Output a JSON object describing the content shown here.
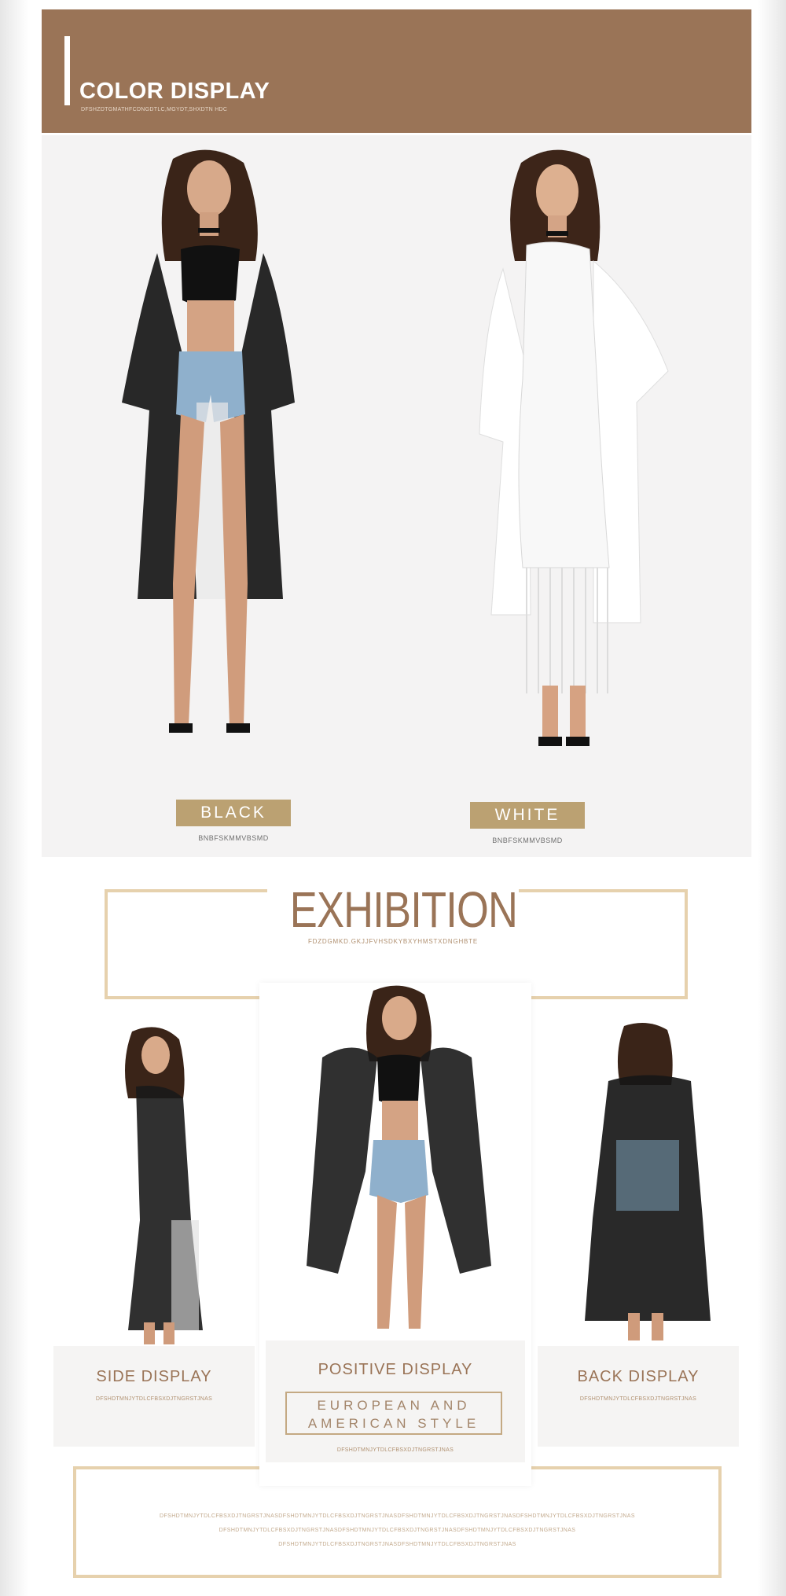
{
  "color_display": {
    "title": "COLOR DISPLAY",
    "subtitle": "DFSHZDTGMATHFCDNGDTLC,MGYDT,SHXDTN HDC"
  },
  "colors": [
    {
      "label": "BLACK",
      "code": "BNBFSKMMVBSMD",
      "swatch": "#111111"
    },
    {
      "label": "WHITE",
      "code": "BNBFSKMMVBSMD",
      "swatch": "#f2f2f2"
    }
  ],
  "exhibition": {
    "title": "EXHIBITION",
    "subtitle": "FDZDGMKD.GKJJFVHSDKYBXYHMSTXDNGHBTE"
  },
  "displays": {
    "side": {
      "title": "SIDE DISPLAY",
      "code": "DFSHDTMNJYTDLCFBSXDJTNGRSTJNAS"
    },
    "positive": {
      "title": "POSITIVE DISPLAY",
      "code": "DFSHDTMNJYTDLCFBSXDJTNGRSTJNAS"
    },
    "back": {
      "title": "BACK DISPLAY",
      "code": "DFSHDTMNJYTDLCFBSXDJTNGRSTJNAS"
    }
  },
  "style_tag": {
    "line1": "EUROPEAN AND",
    "line2": "AMERICAN STYLE"
  },
  "footer_lines": [
    "DFSHDTMNJYTDLCFBSXDJTNGRSTJNASDFSHDTMNJYTDLCFBSXDJTNGRSTJNASDFSHDTMNJYTDLCFBSXDJTNGRSTJNASDFSHDTMNJYTDLCFBSXDJTNGRSTJNAS",
    "DFSHDTMNJYTDLCFBSXDJTNGRSTJNASDFSHDTMNJYTDLCFBSXDJTNGRSTJNASDFSHDTMNJYTDLCFBSXDJTNGRSTJNAS",
    "DFSHDTMNJYTDLCFBSXDJTNGRSTJNASDFSHDTMNJYTDLCFBSXDJTNGRSTJNAS"
  ]
}
